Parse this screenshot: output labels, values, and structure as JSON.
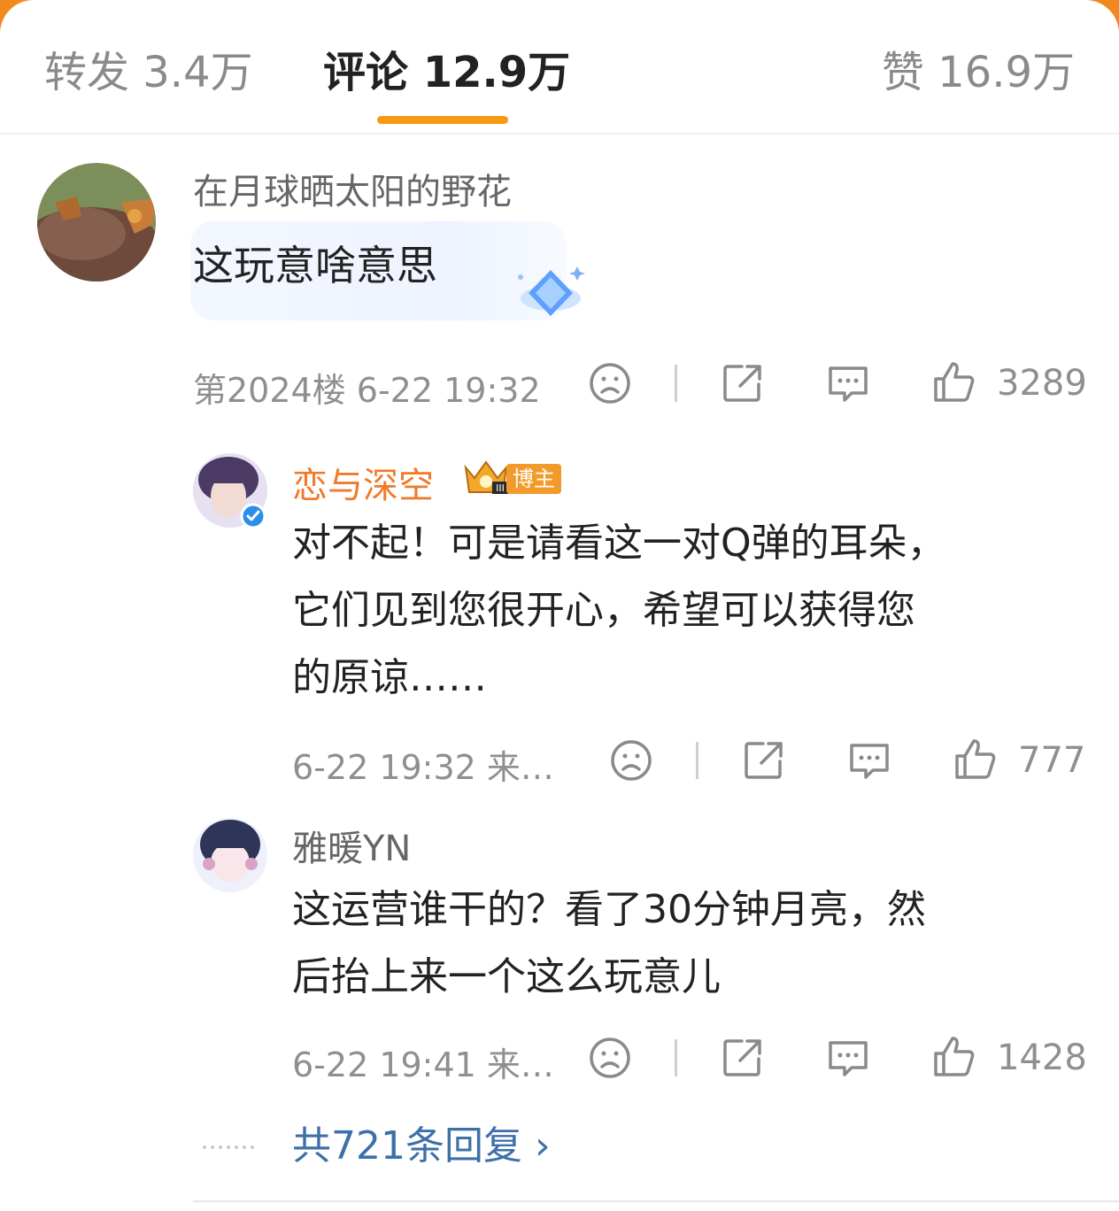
{
  "tabs": {
    "repost": "转发 3.4万",
    "comment": "评论 12.9万",
    "like": "赞 16.9万"
  },
  "accent_color": "#f59a12",
  "comment": {
    "username": "在月球晒太阳的野花",
    "text": "这玩意啥意思",
    "floor_time": "第2024楼 6-22 19:32",
    "likes": "3289"
  },
  "replies": [
    {
      "username": "恋与深空",
      "badge": "博主",
      "text_lines": [
        "对不起！可是请看这一对Q弹的耳朵，",
        "它们见到您很开心，希望可以获得您",
        "的原谅……"
      ],
      "meta": "6-22 19:32 来…",
      "likes": "777"
    },
    {
      "username": "雅暖YN",
      "text_lines": [
        "这运营谁干的？看了30分钟月亮，然",
        "后抬上来一个这么玩意儿"
      ],
      "meta": "6-22 19:41 来…",
      "likes": "1428"
    }
  ],
  "more_replies": "共721条回复 ›",
  "icons": [
    "dislike-face-icon",
    "share-icon",
    "comment-bubble-icon",
    "thumbs-up-icon",
    "crown-icon",
    "verified-icon",
    "diamond-sticker-icon"
  ]
}
